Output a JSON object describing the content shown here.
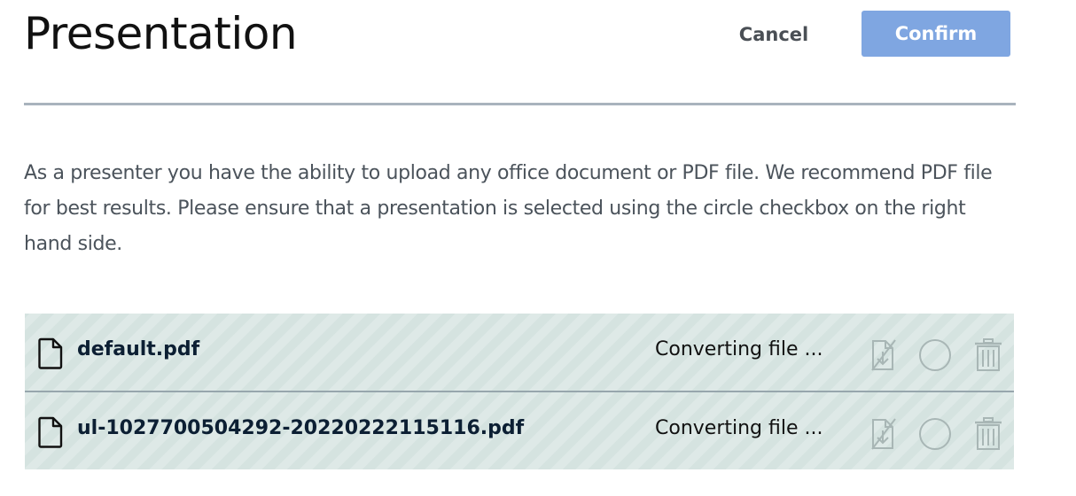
{
  "header": {
    "title": "Presentation",
    "cancel_label": "Cancel",
    "confirm_label": "Confirm"
  },
  "description": "As a presenter you have the ability to upload any office document or PDF file. We recommend PDF file for best results. Please ensure that a presentation is selected using the circle checkbox on the right hand side.",
  "files": [
    {
      "name": "default.pdf",
      "status": "Converting file ...",
      "icons": [
        "document-icon",
        "download-toggle-icon",
        "select-circle-icon",
        "trash-icon"
      ]
    },
    {
      "name": "ul-1027700504292-20220222115116.pdf",
      "status": "Converting file ...",
      "icons": [
        "document-icon",
        "download-toggle-icon",
        "select-circle-icon",
        "trash-icon"
      ]
    }
  ],
  "colors": {
    "confirm_button": "#7fa6e1",
    "list_background": "#d5e3e0",
    "divider": "#a9b3bd",
    "disabled_icon": "#a8b6b5"
  }
}
